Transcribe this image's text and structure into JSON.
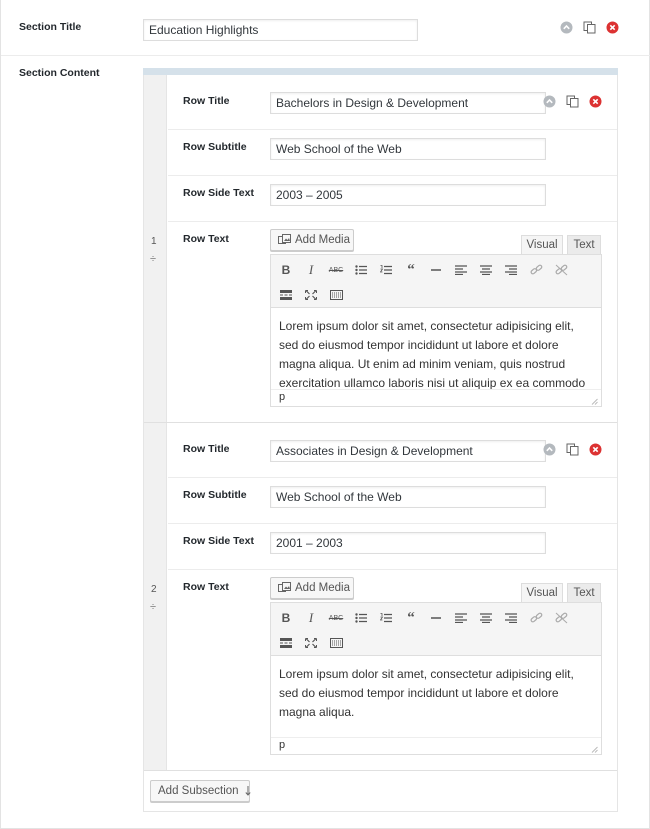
{
  "section": {
    "title_label": "Section Title",
    "title_value": "Education Highlights",
    "content_label": "Section Content"
  },
  "rows": [
    {
      "number": "1",
      "handle": "÷",
      "title_label": "Row Title",
      "title_value": "Bachelors in Design & Development",
      "subtitle_label": "Row Subtitle",
      "subtitle_value": "Web School of the Web",
      "side_label": "Row Side Text",
      "side_value": "2003 – 2005",
      "text_label": "Row Text",
      "body": "Lorem ipsum dolor sit amet, consectetur adipisicing elit, sed do eiusmod tempor incididunt ut labore et dolore magna aliqua. Ut enim ad minim veniam, quis nostrud exercitation ullamco laboris nisi ut aliquip ex ea commodo",
      "path": "p"
    },
    {
      "number": "2",
      "handle": "÷",
      "title_label": "Row Title",
      "title_value": "Associates in Design & Development",
      "subtitle_label": "Row Subtitle",
      "subtitle_value": "Web School of the Web",
      "side_label": "Row Side Text",
      "side_value": "2001 – 2003",
      "text_label": "Row Text",
      "body": "Lorem ipsum dolor sit amet, consectetur adipisicing elit, sed do eiusmod tempor incididunt ut labore et dolore magna aliqua.",
      "path": "p"
    }
  ],
  "editor": {
    "add_media_label": "Add Media",
    "visual_tab": "Visual",
    "text_tab": "Text",
    "toolbar_icons": [
      "bold-icon",
      "italic-icon",
      "strikethrough-icon",
      "bulleted-list-icon",
      "numbered-list-icon",
      "blockquote-icon",
      "horizontal-line-icon",
      "align-left-icon",
      "align-center-icon",
      "align-right-icon",
      "insert-link-icon",
      "remove-link-icon",
      "read-more-icon",
      "fullscreen-icon",
      "toolbar-toggle-icon"
    ]
  },
  "add_subsection_label": "Add Subsection",
  "add_subsection_icon": "down-arrow-icon",
  "colors": {
    "collapse": "#b4b9be",
    "delete": "#dc3232",
    "rail": "#d5e1ea",
    "left_rail": "#f1f1f1"
  }
}
